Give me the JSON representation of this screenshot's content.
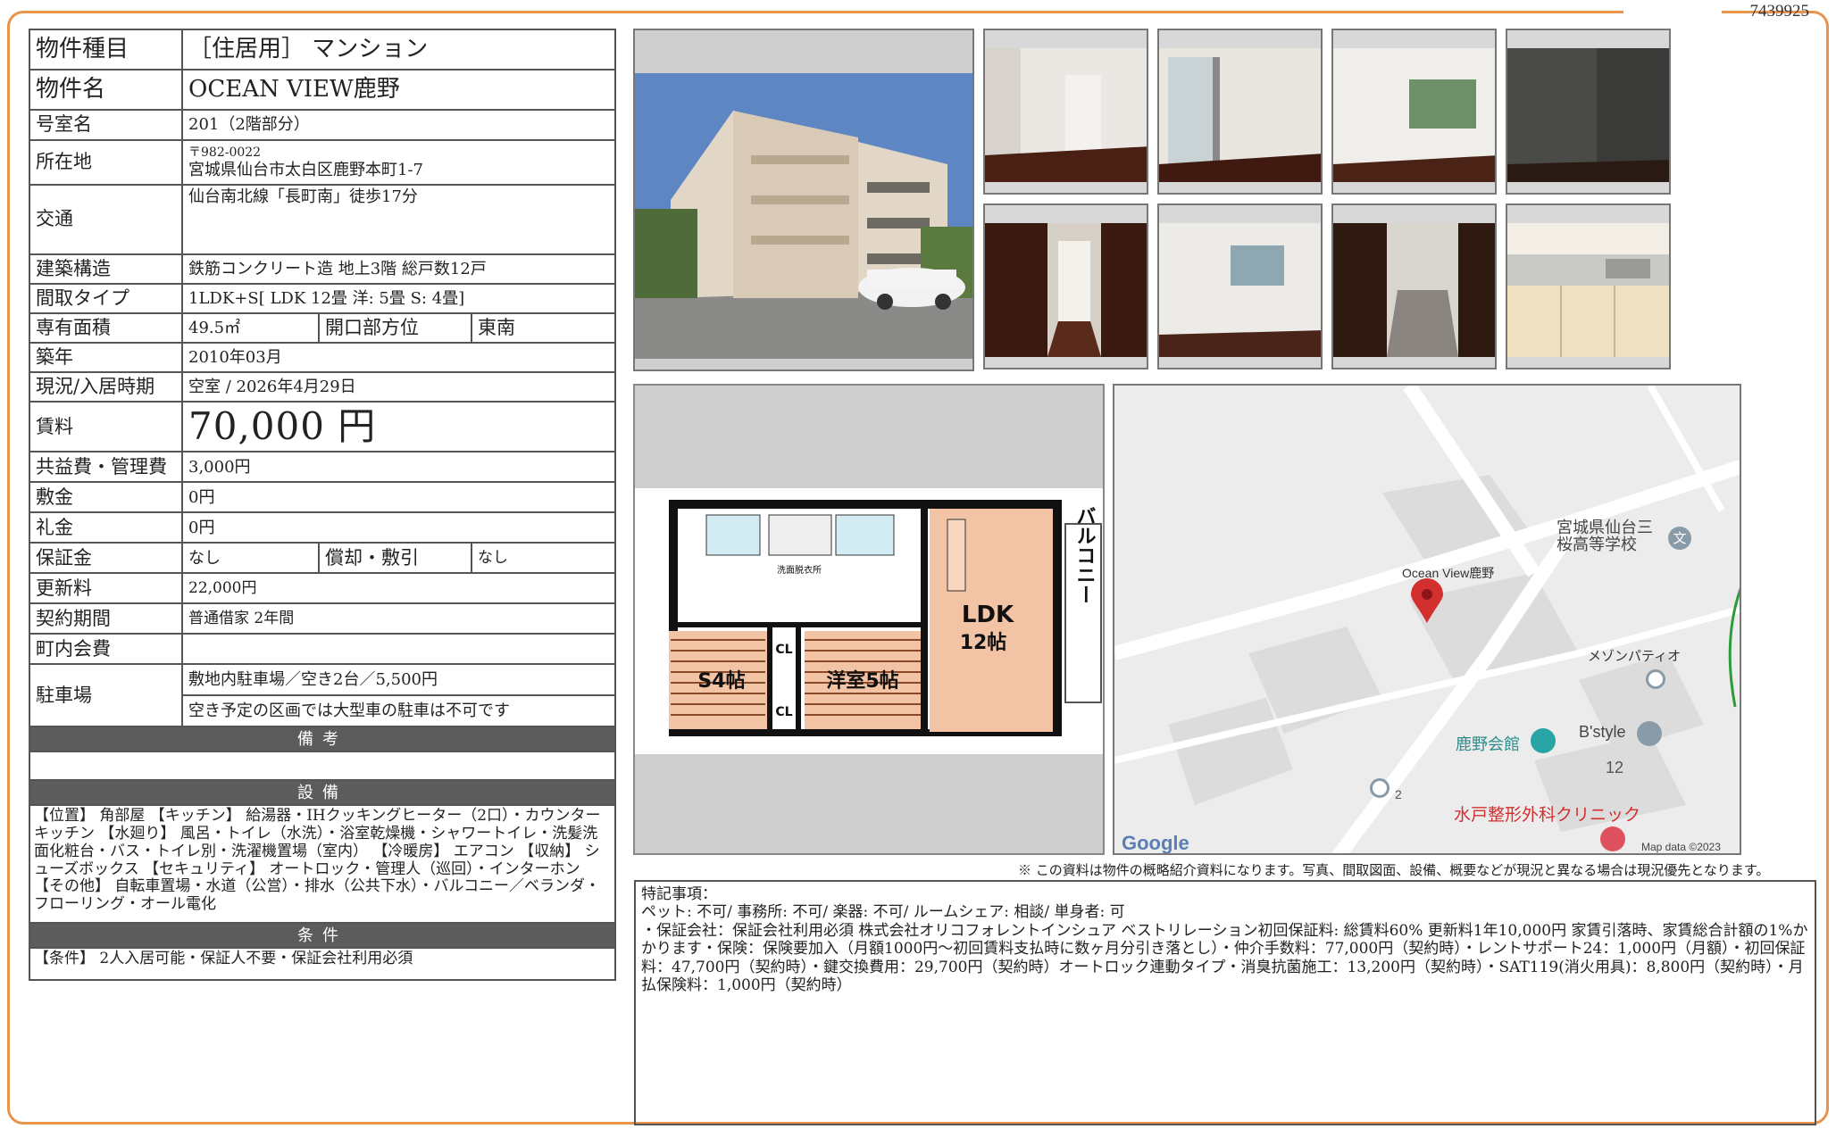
{
  "doc_id": "7439925",
  "property": {
    "type_label": "物件種目",
    "type_value": "［住居用］ マンション",
    "name_label": "物件名",
    "name_value": "OCEAN VIEW鹿野",
    "room_label": "号室名",
    "room_value": "201（2階部分）",
    "address_label": "所在地",
    "postal_code": "〒982-0022",
    "address_value": "宮城県仙台市太白区鹿野本町1-7",
    "transport_label": "交通",
    "transport_value": "仙台南北線「長町南」徒歩17分",
    "structure_label": "建築構造",
    "structure_value": "鉄筋コンクリート造 地上3階 総戸数12戸",
    "layout_label": "間取タイプ",
    "layout_value": "1LDK+S[ LDK 12畳 洋: 5畳 S: 4畳]",
    "area_label": "専有面積",
    "area_value": "49.5㎡",
    "direction_label": "開口部方位",
    "direction_value": "東南",
    "built_label": "築年",
    "built_value": "2010年03月",
    "status_label": "現況/入居時期",
    "status_value": "空室 / 2026年4月29日",
    "rent_label": "賃料",
    "rent_value": "70,000 円",
    "fee_label": "共益費・管理費",
    "fee_value": "3,000円",
    "deposit_label": "敷金",
    "deposit_value": "0円",
    "key_money_label": "礼金",
    "key_money_value": "0円",
    "guarantee_label": "保証金",
    "guarantee_value": "なし",
    "amortization_label": "償却・敷引",
    "amortization_value": "なし",
    "renewal_label": "更新料",
    "renewal_value": "22,000円",
    "contract_label": "契約期間",
    "contract_value": "普通借家 2年間",
    "community_label": "町内会費",
    "community_value": "",
    "parking_label": "駐車場",
    "parking_value1": "敷地内駐車場／空き2台／5,500円",
    "parking_value2": "空き予定の区画では大型車の駐車は不可です"
  },
  "sections": {
    "remarks_title": "備考",
    "remarks_text": "",
    "equipment_title": "設備",
    "equipment_text": "【位置】 角部屋 【キッチン】 給湯器・IHクッキングヒーター（2口）・カウンターキッチン 【水廻り】 風呂・トイレ（水洗）・浴室乾燥機・シャワートイレ・洗髪洗面化粧台・バス・トイレ別・洗濯機置場（室内） 【冷暖房】 エアコン 【収納】 シューズボックス 【セキュリティ】 オートロック・管理人（巡回）・インターホン 【その他】 自転車置場・水道（公営）・排水（公共下水）・バルコニー／ベランダ・フローリング・オール電化",
    "conditions_title": "条件",
    "conditions_text": "【条件】 2人入居可能・保証人不要・保証会社利用必須"
  },
  "floorplan": {
    "ldk_label": "LDK",
    "ldk_size": "12帖",
    "room1_label": "洋室5帖",
    "room2_label": "S4帖",
    "balcony_label": "バルコニー",
    "closet_label": "CL",
    "washroom_label": "洗面脱衣所"
  },
  "map": {
    "place_name": "Ocean View鹿野",
    "school_name": "宮城県仙台三\n桜高等学校",
    "labels": [
      "メゾンパティオ",
      "鹿野会館",
      "B'style",
      "12",
      "2",
      "水戸整形外科クリニック"
    ],
    "google": "Google",
    "map_data": "Map data ©2023"
  },
  "disclaimer": "※ この資料は物件の概略紹介資料になります。写真、間取図面、設備、概要などが現況と異なる場合は現況優先となります。",
  "notes": {
    "title": "特記事項：",
    "line1": "ペット: 不可/ 事務所: 不可/ 楽器: 不可/ ルームシェア: 相談/ 単身者: 可",
    "body": "・保証会社：保証会社利用必須 株式会社オリコフォレントインシュア ベストリレーション初回保証料: 総賃料60% 更新料1年10,000円 家賃引落時、家賃総合計額の1%かかります・保険：保険要加入（月額1000円～初回賃料支払時に数ヶ月分引き落とし）・仲介手数料：77,000円（契約時）・レントサポート24：1,000円（月額）・初回保証料：47,700円（契約時）・鍵交換費用：29,700円（契約時）オートロック連動タイプ・消臭抗菌施工：13,200円（契約時）・SAT119(消火用具)：8,800円（契約時）・月払保険料：1,000円（契約時）"
  },
  "colors": {
    "frame": "#e8944a",
    "section_bg": "#5c5c5c",
    "map_pin": "#d32f2f"
  }
}
